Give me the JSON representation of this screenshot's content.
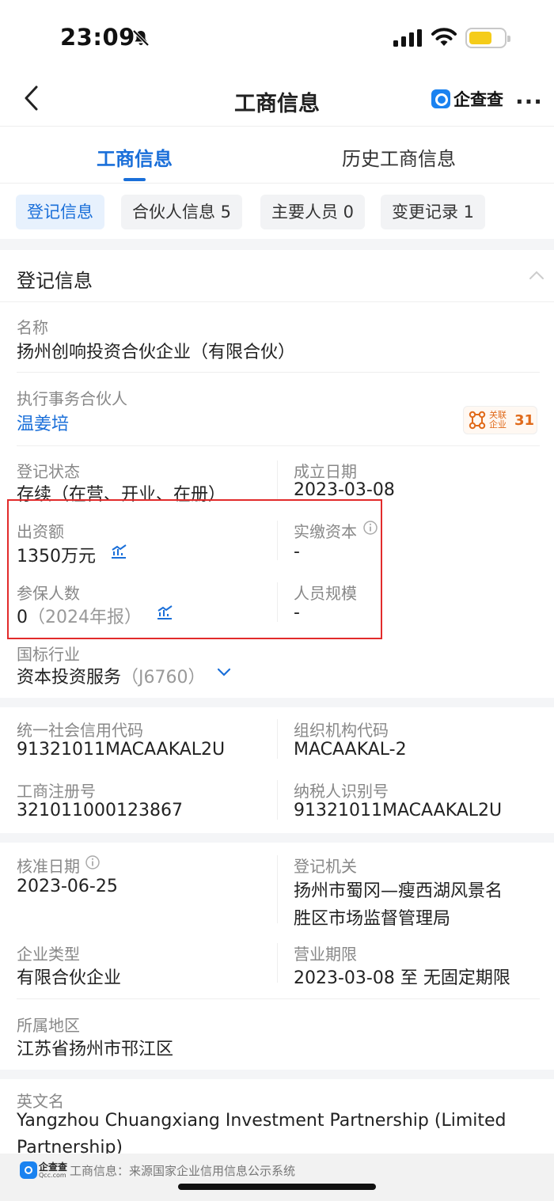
{
  "status_bar": {
    "time": "23:09"
  },
  "nav": {
    "title": "工商信息",
    "brand": "企查查"
  },
  "tabs": [
    {
      "label": "工商信息"
    },
    {
      "label": "历史工商信息"
    }
  ],
  "chips": [
    {
      "label": "登记信息"
    },
    {
      "label": "合伙人信息 5"
    },
    {
      "label": "主要人员 0"
    },
    {
      "label": "变更记录 1"
    }
  ],
  "section": {
    "title": "登记信息"
  },
  "fields": {
    "name": {
      "label": "名称",
      "value": "扬州创响投资合伙企业（有限合伙）"
    },
    "partner": {
      "label": "执行事务合伙人",
      "value": "温姜培",
      "badge_text": "关联企业",
      "badge_count": "31"
    },
    "reg_status": {
      "label": "登记状态",
      "value": "存续（在营、开业、在册）"
    },
    "founded": {
      "label": "成立日期",
      "value": "2023-03-08"
    },
    "capital": {
      "label": "出资额",
      "value": "1350万元"
    },
    "paid_capital": {
      "label": "实缴资本",
      "value": "-"
    },
    "insured": {
      "label": "参保人数",
      "value": "0",
      "note": "（2024年报）"
    },
    "staff_size": {
      "label": "人员规模",
      "value": "-"
    },
    "industry": {
      "label": "国标行业",
      "value": "资本投资服务",
      "code": "（J6760）"
    },
    "credit_code": {
      "label": "统一社会信用代码",
      "value": "91321011MACAAKAL2U"
    },
    "org_code": {
      "label": "组织机构代码",
      "value": "MACAAKAL-2"
    },
    "reg_no": {
      "label": "工商注册号",
      "value": "321011000123867"
    },
    "tax_no": {
      "label": "纳税人识别号",
      "value": "91321011MACAAKAL2U"
    },
    "approval_date": {
      "label": "核准日期",
      "value": "2023-06-25"
    },
    "authority": {
      "label": "登记机关",
      "value_line1": "扬州市蜀冈—瘦西湖风景名",
      "value_line2": "胜区市场监督管理局"
    },
    "company_type": {
      "label": "企业类型",
      "value": "有限合伙企业"
    },
    "term": {
      "label": "营业期限",
      "value": "2023-03-08 至 无固定期限"
    },
    "region": {
      "label": "所属地区",
      "value": "江苏省扬州市邗江区"
    },
    "english_name": {
      "label": "英文名",
      "value_line1": "Yangzhou Chuangxiang Investment Partnership (Limited",
      "value_line2": "Partnership)"
    }
  },
  "footer": {
    "brand": "企查查",
    "domain": "Qcc.com",
    "source": "工商信息：来源国家企业信用信息公示系统"
  },
  "colors": {
    "accent": "#1a6fd9",
    "highlight_box": "#e22b2b",
    "badge": "#e06a1a",
    "battery": "#f5cc19"
  }
}
